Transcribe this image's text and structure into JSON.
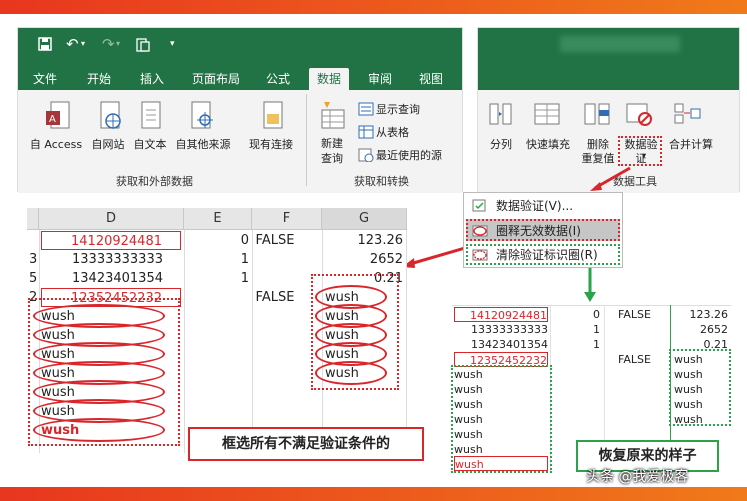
{
  "ribbon": {
    "tabs": [
      "文件",
      "开始",
      "插入",
      "页面布局",
      "公式",
      "数据",
      "审阅",
      "视图"
    ],
    "active_tab": "数据",
    "get_external_group": "获取和外部数据",
    "get_transform_group": "获取和转换",
    "data_tools_group": "数据工具",
    "buttons": {
      "access": "自 Access",
      "web": "自网站",
      "text": "自文本",
      "other": "自其他来源",
      "existing": "现有连接",
      "new_query_1": "新建",
      "new_query_2": "查询",
      "show_query": "显示查询",
      "from_table": "从表格",
      "recent_sources": "最近使用的源",
      "split": "分列",
      "flash_fill": "快速填充",
      "remove_dup_1": "删除",
      "remove_dup_2": "重复值",
      "validation_1": "数据验",
      "validation_2": "证",
      "consolidate": "合并计算"
    }
  },
  "dropdown": {
    "items": [
      "数据验证(V)...",
      "圈释无效数据(I)",
      "清除验证标识圈(R)"
    ]
  },
  "sheet": {
    "columns": [
      "D",
      "E",
      "F",
      "G"
    ],
    "rows": [
      {
        "rn": "",
        "d": "14120924481",
        "e": "0",
        "f": "FALSE",
        "g": "123.26"
      },
      {
        "rn": "3",
        "d": "13333333333",
        "e": "1",
        "f": "",
        "g": "2652"
      },
      {
        "rn": "5",
        "d": "13423401354",
        "e": "1",
        "f": "",
        "g": "0.21"
      },
      {
        "rn": "2",
        "d": "12352452232",
        "e": "",
        "f": "FALSE",
        "g": "wush"
      },
      {
        "rn": "",
        "d": "wush",
        "e": "",
        "f": "",
        "g": "wush"
      },
      {
        "rn": "",
        "d": "wush",
        "e": "",
        "f": "",
        "g": "wush"
      },
      {
        "rn": "",
        "d": "wush",
        "e": "",
        "f": "",
        "g": "wush"
      },
      {
        "rn": "",
        "d": "wush",
        "e": "",
        "f": "",
        "g": "wush"
      },
      {
        "rn": "",
        "d": "wush",
        "e": "",
        "f": "",
        "g": ""
      },
      {
        "rn": "",
        "d": "wush",
        "e": "",
        "f": "",
        "g": ""
      },
      {
        "rn": "",
        "d": "wush",
        "e": "",
        "f": "",
        "g": ""
      }
    ]
  },
  "right_table": {
    "rows": [
      {
        "d": "14120924481",
        "e": "0",
        "f": "FALSE",
        "g": "123.26"
      },
      {
        "d": "13333333333",
        "e": "1",
        "f": "",
        "g": "2652"
      },
      {
        "d": "13423401354",
        "e": "1",
        "f": "",
        "g": "0.21"
      },
      {
        "d": "12352452232",
        "e": "",
        "f": "FALSE",
        "g": "wush"
      },
      {
        "d": "wush",
        "e": "",
        "f": "",
        "g": "wush"
      },
      {
        "d": "wush",
        "e": "",
        "f": "",
        "g": "wush"
      },
      {
        "d": "wush",
        "e": "",
        "f": "",
        "g": "wush"
      },
      {
        "d": "wush",
        "e": "",
        "f": "",
        "g": "wush"
      },
      {
        "d": "wush",
        "e": "",
        "f": "",
        "g": ""
      },
      {
        "d": "wush",
        "e": "",
        "f": "",
        "g": ""
      },
      {
        "d": "wush",
        "e": "",
        "f": "",
        "g": ""
      }
    ]
  },
  "labels": {
    "select_invalid": "框选所有不满足验证条件的",
    "restore": "恢复原来的样子",
    "watermark": "头条 @我爱极客"
  },
  "colors": {
    "excel_green": "#217346",
    "red": "#d9262b",
    "green": "#2aa34a"
  }
}
